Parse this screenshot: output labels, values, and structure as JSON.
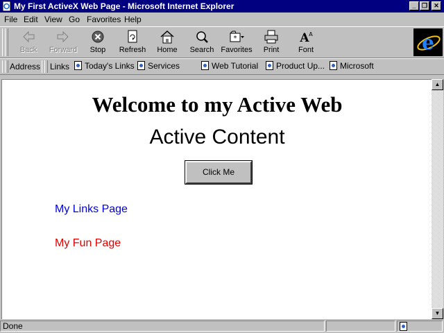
{
  "window": {
    "title": "My First ActiveX Web Page - Microsoft Internet Explorer"
  },
  "menu": [
    "File",
    "Edit",
    "View",
    "Go",
    "Favorites",
    "Help"
  ],
  "toolbar": {
    "back": "Back",
    "forward": "Forward",
    "stop": "Stop",
    "refresh": "Refresh",
    "home": "Home",
    "search": "Search",
    "favorites": "Favorites",
    "print": "Print",
    "font": "Font"
  },
  "linksbar": {
    "address_label": "Address",
    "links_label": "Links",
    "links": [
      "Today's Links",
      "Services",
      "Web Tutorial",
      "Product Up...",
      "Microsoft"
    ]
  },
  "page": {
    "heading": "Welcome to my Active Web",
    "subheading": "Active Content",
    "button": "Click Me",
    "link1": "My Links Page",
    "link2": "My Fun Page"
  },
  "status": {
    "text": "Done"
  },
  "colors": {
    "titlebar": "#000080",
    "link_blue": "#0000e0",
    "link_red": "#e00000",
    "chrome": "#c0c0c0"
  },
  "icons": [
    "ie-page-icon",
    "back-arrow-icon",
    "forward-arrow-icon",
    "stop-icon",
    "refresh-icon",
    "home-icon",
    "search-icon",
    "favorites-icon",
    "print-icon",
    "font-icon",
    "ie-logo-icon",
    "page-link-icon"
  ]
}
